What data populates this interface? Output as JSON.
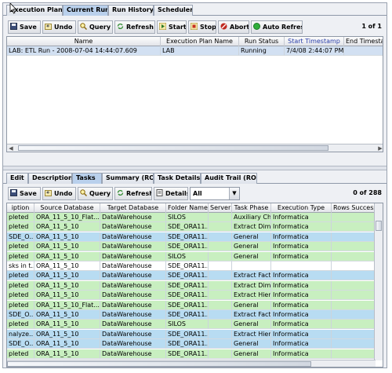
{
  "top_tabs": [
    "Execution Plans",
    "Current Run",
    "Run History",
    "Scheduler"
  ],
  "top_toolbar": {
    "save": "Save",
    "undo": "Undo",
    "query": "Query",
    "refresh": "Refresh",
    "start": "Start",
    "stop": "Stop",
    "abort": "Abort",
    "auto_refresh": "Auto Refresh",
    "count": "1 of 1"
  },
  "run_table": {
    "columns": [
      "Name",
      "Execution Plan Name",
      "Run Status",
      "Start Timestamp",
      "End Timestamp"
    ],
    "rows": [
      [
        "LAB: ETL Run - 2008-07-04 14:44:07.609",
        "LAB",
        "Running",
        "7/4/08 2:44:07 PM",
        ""
      ]
    ]
  },
  "bottom_tabs": [
    "Edit",
    "Description",
    "Tasks",
    "Summary (RO)",
    "Task Details",
    "Audit Trail (RO)"
  ],
  "bottom_toolbar": {
    "save": "Save",
    "undo": "Undo",
    "query": "Query",
    "refresh": "Refresh",
    "details": "Details",
    "filter_value": "All",
    "count": "0 of 288"
  },
  "task_table": {
    "columns": [
      "iption",
      "Source Database",
      "Target Database",
      "Folder Name",
      "Server",
      "Task Phase",
      "Execution Type",
      "Rows Success"
    ],
    "rows": [
      [
        "pleted",
        "ORA_11_5_10_Flat...",
        "DataWarehouse",
        "SILOS",
        "",
        "Auxiliary Ch...",
        "Informatica",
        ""
      ],
      [
        "pleted",
        "ORA_11_5_10",
        "DataWarehouse",
        "SDE_ORA11...",
        "",
        "Extract Dim...",
        "Informatica",
        ""
      ],
      [
        "SDE_O...",
        "ORA_11_5_10",
        "DataWarehouse",
        "SDE_ORA11...",
        "",
        "General",
        "Informatica",
        ""
      ],
      [
        "pleted",
        "ORA_11_5_10",
        "DataWarehouse",
        "SDE_ORA11...",
        "",
        "General",
        "Informatica",
        ""
      ],
      [
        "pleted",
        "ORA_11_5_10",
        "DataWarehouse",
        "SILOS",
        "",
        "General",
        "Informatica",
        ""
      ],
      [
        "sks in t...",
        "ORA_11_5_10",
        "DataWarehouse",
        "SDE_ORA11...",
        "",
        "",
        "",
        ""
      ],
      [
        "pleted",
        "ORA_11_5_10",
        "DataWarehouse",
        "SDE_ORA11...",
        "",
        "Extract Fact",
        "Informatica",
        ""
      ],
      [
        "pleted",
        "ORA_11_5_10",
        "DataWarehouse",
        "SDE_ORA11...",
        "",
        "Extract Dim...",
        "Informatica",
        ""
      ],
      [
        "pleted",
        "ORA_11_5_10",
        "DataWarehouse",
        "SDE_ORA11...",
        "",
        "Extract Hier...",
        "Informatica",
        ""
      ],
      [
        "pleted",
        "ORA_11_5_10_Flat...",
        "DataWarehouse",
        "SDE_ORA11...",
        "",
        "General",
        "Informatica",
        ""
      ],
      [
        "SDE_O...",
        "ORA_11_5_10",
        "DataWarehouse",
        "SDE_ORA11...",
        "",
        "Extract Fact",
        "Informatica",
        ""
      ],
      [
        "pleted",
        "ORA_11_5_10",
        "DataWarehouse",
        "SILOS",
        "",
        "General",
        "Informatica",
        ""
      ],
      [
        "nalyze...",
        "ORA_11_5_10",
        "DataWarehouse",
        "SDE_ORA11...",
        "",
        "Extract Hier...",
        "Informatica",
        ""
      ],
      [
        "SDE_O...",
        "ORA_11_5_10",
        "DataWarehouse",
        "SDE_ORA11...",
        "",
        "General",
        "Informatica",
        ""
      ],
      [
        "pleted",
        "ORA_11_5_10",
        "DataWarehouse",
        "SDE_ORA11...",
        "",
        "General",
        "Informatica",
        ""
      ]
    ],
    "row_status": [
      "green",
      "green",
      "blue",
      "green",
      "green",
      "white",
      "blue",
      "green",
      "green",
      "green",
      "blue",
      "green",
      "blue",
      "blue",
      "green"
    ]
  },
  "colors": {
    "green": "#c8efc0",
    "blue": "#b8dcf2",
    "white": "#ffffff",
    "selected": "#d2e0f2"
  }
}
